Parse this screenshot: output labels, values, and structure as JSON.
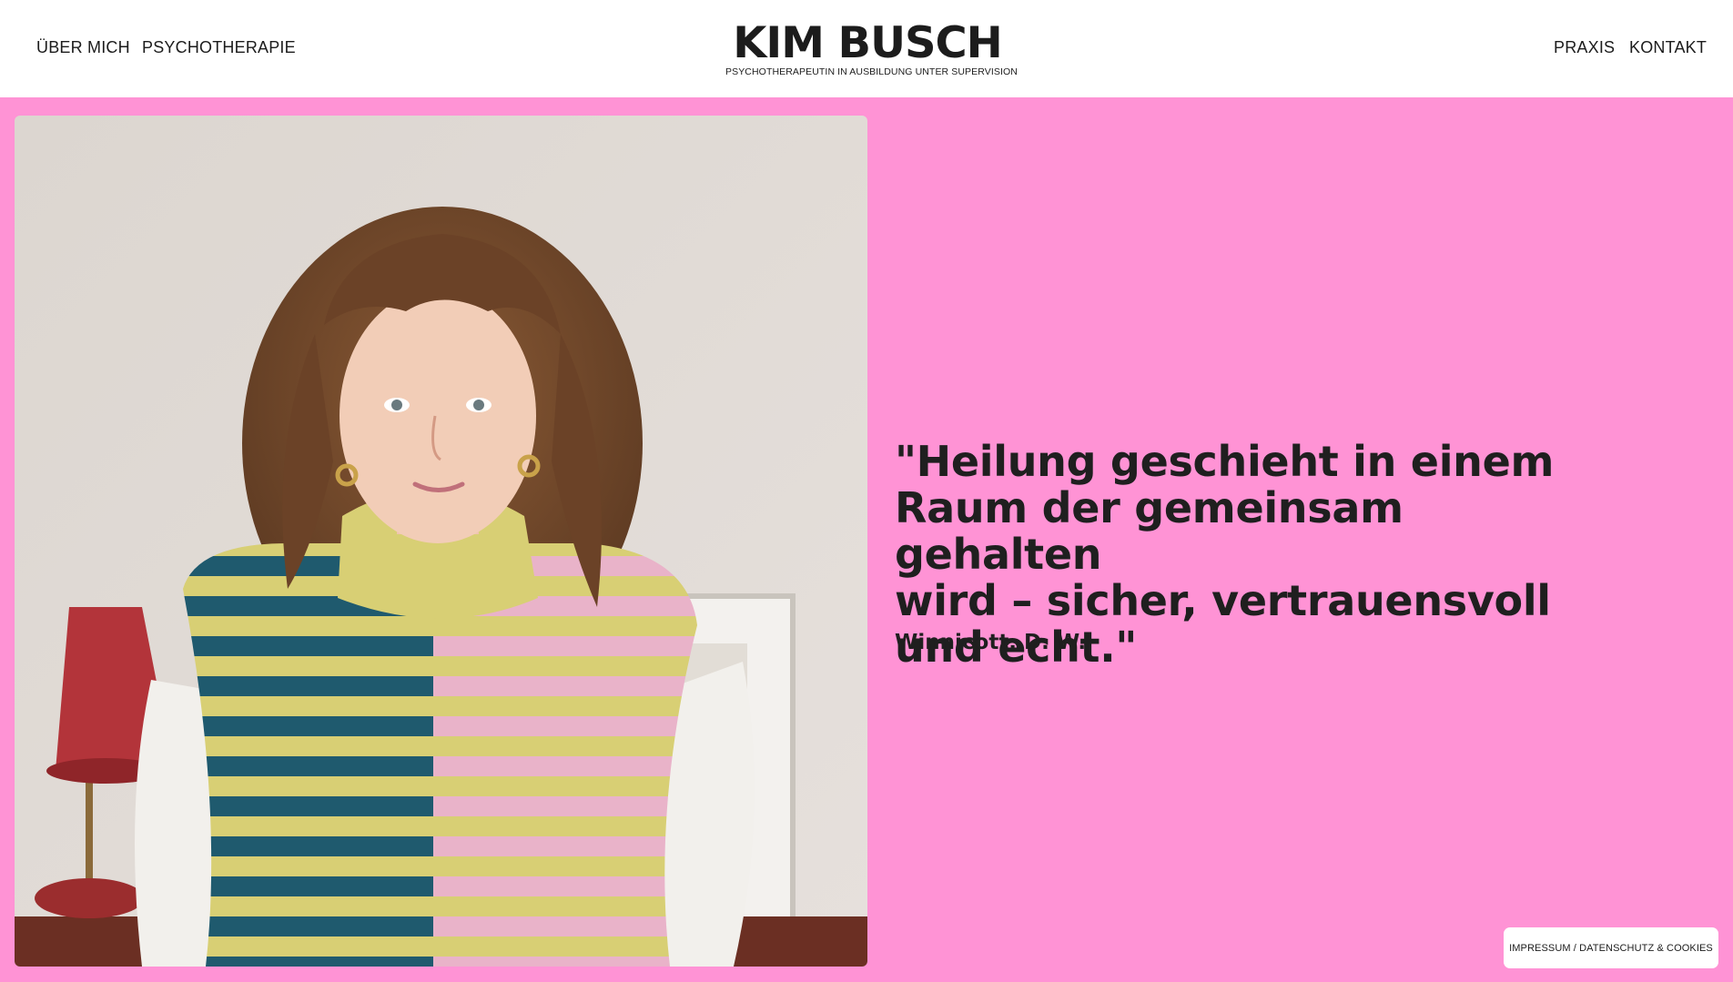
{
  "header": {
    "nav_left": [
      "ÜBER MICH",
      "PSYCHOTHERAPIE"
    ],
    "nav_right": [
      "PRAXIS",
      "KONTAKT"
    ],
    "logo_title": "KIM BUSCH",
    "logo_subtitle": "PSYCHOTHERAPEUTIN IN AUSBILDUNG UNTER SUPERVISION"
  },
  "main": {
    "quote_lines": [
      "\"Heilung geschieht in einem",
      "Raum der gemeinsam gehalten",
      "wird – sicher, vertrauensvoll",
      "und echt.\""
    ],
    "quote_author": "Winnicott, D. W."
  },
  "footer": {
    "legal_label": "IMPRESSUM / DATENSCHUTZ & COOKIES"
  },
  "colors": {
    "page_background": "#ff93d5",
    "header_background": "#ffffff",
    "text": "#1c1c1c"
  }
}
